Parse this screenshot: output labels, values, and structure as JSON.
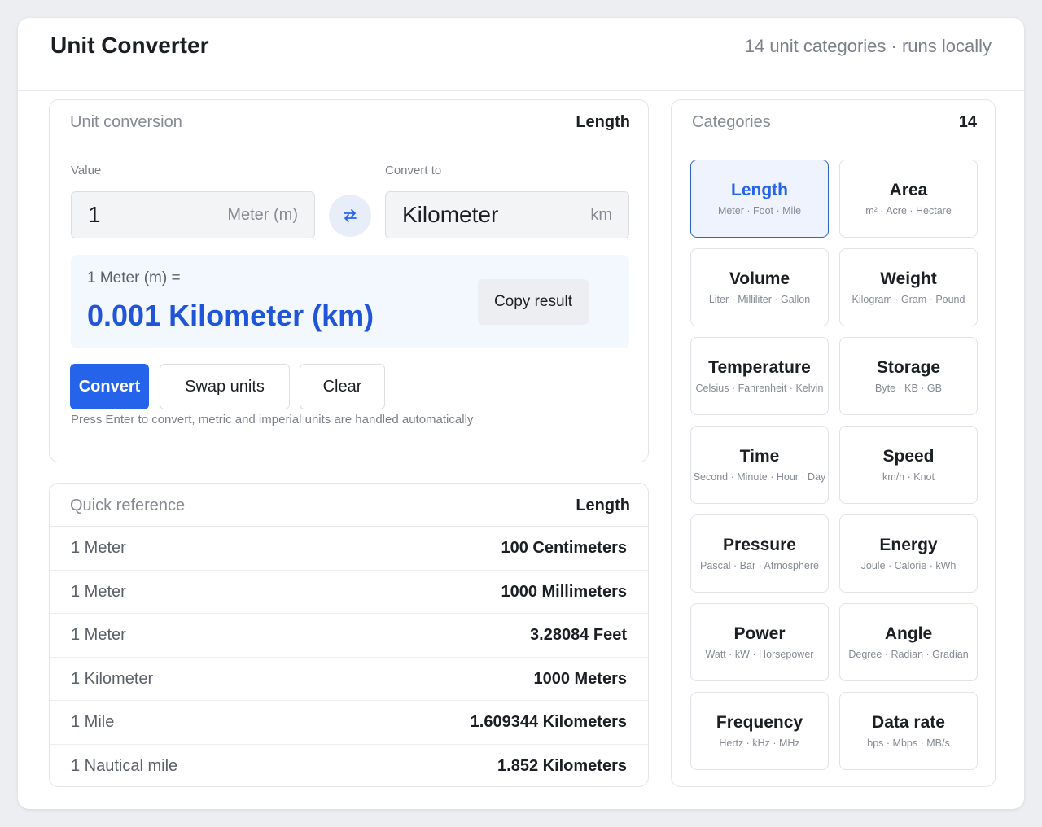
{
  "header": {
    "title": "Unit Converter",
    "subtitle": "14 unit categories · runs locally"
  },
  "converter": {
    "panel_label": "Unit conversion",
    "category": "Length",
    "value_label": "Value",
    "value": "1",
    "from_unit": "Meter (m)",
    "to_label": "Convert to",
    "to_unit": "Kilometer",
    "to_symbol": "km",
    "swap_icon": "swap-arrows-icon",
    "result_equation": "1 Meter (m) =",
    "result_value": "0.001 Kilometer (km)",
    "copy_label": "Copy result",
    "convert_label": "Convert",
    "swap_label": "Swap units",
    "clear_label": "Clear",
    "hint": "Press Enter to convert, metric and imperial units are handled automatically"
  },
  "reference": {
    "panel_label": "Quick reference",
    "category": "Length",
    "rows": [
      {
        "left": "1 Meter",
        "right": "100 Centimeters"
      },
      {
        "left": "1 Meter",
        "right": "1000 Millimeters"
      },
      {
        "left": "1 Meter",
        "right": "3.28084 Feet"
      },
      {
        "left": "1 Kilometer",
        "right": "1000 Meters"
      },
      {
        "left": "1 Mile",
        "right": "1.609344 Kilometers"
      },
      {
        "left": "1 Nautical mile",
        "right": "1.852 Kilometers"
      }
    ]
  },
  "categories": {
    "panel_label": "Categories",
    "count": "14",
    "items": [
      {
        "name": "Length",
        "units": "Meter · Foot · Mile",
        "active": true
      },
      {
        "name": "Area",
        "units": "m² · Acre · Hectare"
      },
      {
        "name": "Volume",
        "units": "Liter · Milliliter · Gallon"
      },
      {
        "name": "Weight",
        "units": "Kilogram · Gram · Pound"
      },
      {
        "name": "Temperature",
        "units": "Celsius · Fahrenheit · Kelvin"
      },
      {
        "name": "Storage",
        "units": "Byte · KB · GB"
      },
      {
        "name": "Time",
        "units": "Second · Minute · Hour · Day"
      },
      {
        "name": "Speed",
        "units": "km/h · Knot"
      },
      {
        "name": "Pressure",
        "units": "Pascal · Bar · Atmosphere"
      },
      {
        "name": "Energy",
        "units": "Joule · Calorie · kWh"
      },
      {
        "name": "Power",
        "units": "Watt · kW · Horsepower"
      },
      {
        "name": "Angle",
        "units": "Degree · Radian · Gradian"
      },
      {
        "name": "Frequency",
        "units": "Hertz · kHz · MHz"
      },
      {
        "name": "Data rate",
        "units": "bps · Mbps · MB/s"
      }
    ]
  },
  "colors": {
    "accent": "#2563eb",
    "result_text": "#1f55d6",
    "active_card_bg": "#eef3fe"
  }
}
